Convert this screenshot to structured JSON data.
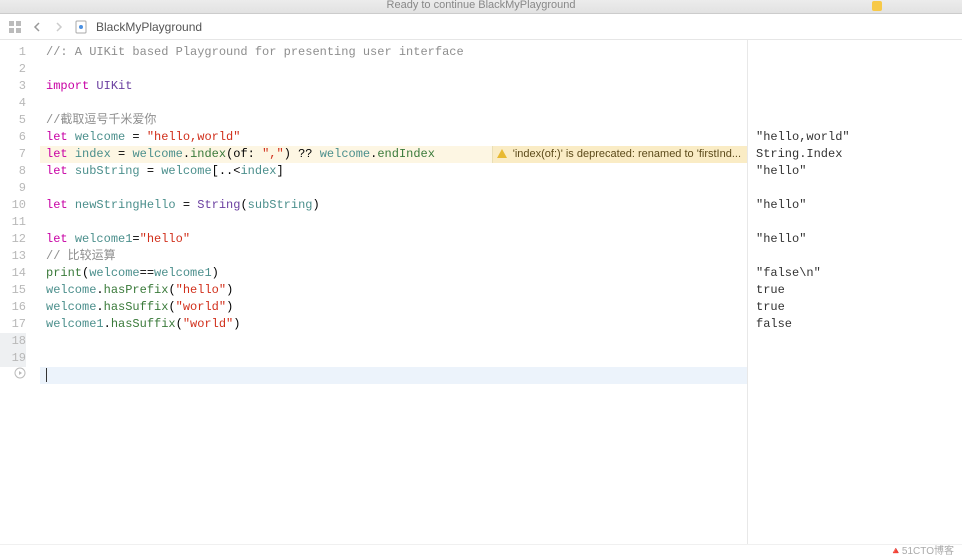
{
  "titlebar": {
    "status": "Ready to continue BlackMyPlayground"
  },
  "breadcrumb": {
    "file": "BlackMyPlayground"
  },
  "code": {
    "lines": [
      {
        "n": "1",
        "type": "comment",
        "text": "//: A UIKit based Playground for presenting user interface"
      },
      {
        "n": "2",
        "type": "blank",
        "text": ""
      },
      {
        "n": "3",
        "type": "import",
        "kw": "import",
        "mod": "UIKit"
      },
      {
        "n": "4",
        "type": "blank",
        "text": ""
      },
      {
        "n": "5",
        "type": "comment",
        "text": "//截取逗号千米爱你"
      },
      {
        "n": "6",
        "type": "let",
        "kw": "let",
        "name": "welcome",
        "rest": " = ",
        "str": "\"hello,world\""
      },
      {
        "n": "7",
        "type": "idx",
        "kw": "let",
        "name": "index",
        "eq": " = ",
        "obj": "welcome",
        "dot1": ".",
        "m1": "index",
        "args1": "(of: ",
        "str1": "\",\"",
        "args1b": ")",
        "nilco": " ?? ",
        "obj2": "welcome",
        "dot2": ".",
        "m2": "endIndex",
        "warn": "'index(of:)' is deprecated: renamed to 'firstInd..."
      },
      {
        "n": "8",
        "type": "sub",
        "kw": "let",
        "name": "subString",
        "eq": " = ",
        "obj": "welcome",
        "rest": "[..<",
        "ref": "index",
        "rest2": "]"
      },
      {
        "n": "9",
        "type": "blank",
        "text": ""
      },
      {
        "n": "10",
        "type": "new",
        "kw": "let",
        "name": "newStringHello",
        "eq": " = ",
        "ty": "String",
        "open": "(",
        "ref": "subString",
        "close": ")"
      },
      {
        "n": "11",
        "type": "blank",
        "text": ""
      },
      {
        "n": "12",
        "type": "let",
        "kw": "let",
        "name": "welcome1",
        "rest": "=",
        "str": "\"hello\""
      },
      {
        "n": "13",
        "type": "comment",
        "text": "// 比较运算"
      },
      {
        "n": "14",
        "type": "call",
        "fn": "print",
        "open": "(",
        "a": "welcome",
        "op": "==",
        "b": "welcome1",
        "close": ")"
      },
      {
        "n": "15",
        "type": "mcall",
        "obj": "welcome",
        "dot": ".",
        "m": "hasPrefix",
        "open": "(",
        "str": "\"hello\"",
        "close": ")"
      },
      {
        "n": "16",
        "type": "mcall",
        "obj": "welcome",
        "dot": ".",
        "m": "hasSuffix",
        "open": "(",
        "str": "\"world\"",
        "close": ")"
      },
      {
        "n": "17",
        "type": "mcall",
        "obj": "welcome1",
        "dot": ".",
        "m": "hasSuffix",
        "open": "(",
        "str": "\"world\"",
        "close": ")"
      },
      {
        "n": "18",
        "type": "blank",
        "text": ""
      },
      {
        "n": "19",
        "type": "blank",
        "text": ""
      }
    ]
  },
  "results": [
    {
      "row": 6,
      "text": "\"hello,world\""
    },
    {
      "row": 7,
      "text": "String.Index"
    },
    {
      "row": 8,
      "text": "\"hello\""
    },
    {
      "row": 10,
      "text": "\"hello\""
    },
    {
      "row": 12,
      "text": "\"hello\""
    },
    {
      "row": 14,
      "text": "\"false\\n\""
    },
    {
      "row": 15,
      "text": "true"
    },
    {
      "row": 16,
      "text": "true"
    },
    {
      "row": 17,
      "text": "false"
    }
  ],
  "footer": {
    "watermark": "🔺51CTO博客"
  },
  "colors": {
    "keyword": "#c800a4",
    "type": "#6b3fa0",
    "method": "#3a7a3a",
    "string": "#d12f1b",
    "comment": "#8e8e8e",
    "warn_bg": "#fdf6e3"
  }
}
